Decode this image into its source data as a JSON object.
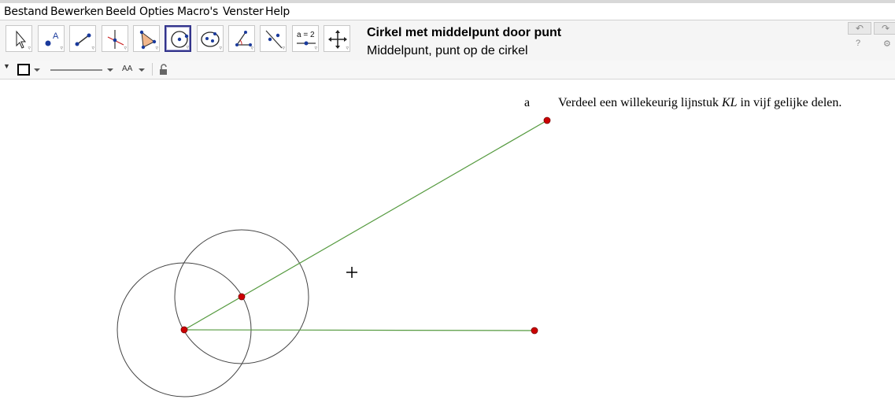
{
  "menu": [
    "Bestand",
    "Bewerken",
    "Beeld",
    "Opties",
    "Macro's",
    "Venster",
    "Help"
  ],
  "toolbar": {
    "tools": [
      {
        "name": "move-tool",
        "icon": "arrow-pointer-icon"
      },
      {
        "name": "point-tool",
        "icon": "point-icon"
      },
      {
        "name": "line-tool",
        "icon": "line-through-points-icon"
      },
      {
        "name": "perpendicular-tool",
        "icon": "perpendicular-line-icon"
      },
      {
        "name": "polygon-tool",
        "icon": "polygon-icon"
      },
      {
        "name": "circle-center-point-tool",
        "icon": "circle-center-point-icon",
        "active": true
      },
      {
        "name": "ellipse-tool",
        "icon": "ellipse-icon"
      },
      {
        "name": "angle-tool",
        "icon": "angle-icon"
      },
      {
        "name": "reflect-tool",
        "icon": "reflect-icon"
      },
      {
        "name": "slider-tool",
        "icon": "slider-icon",
        "label": "a = 2"
      },
      {
        "name": "move-view-tool",
        "icon": "move-graphics-view-icon"
      }
    ],
    "active_tool_title": "Cirkel met middelpunt door punt",
    "active_tool_help": "Middelpunt, punt op de cirkel",
    "undo_icon": "undo-icon",
    "redo_icon": "redo-icon",
    "help_icon": "help-icon",
    "settings_icon": "settings-icon"
  },
  "stylebar": {
    "point_style_icon": "square-style-icon",
    "line_style_icon": "line-style-icon",
    "label_style_label": "AA",
    "lock_icon": "lock-icon"
  },
  "canvas": {
    "label_a": "a",
    "instruction_prefix": "Verdeel een willekeurig lijnstuk ",
    "instruction_var": "KL",
    "instruction_suffix": " in vijf gelijke delen.",
    "colors": {
      "segment": "#559a3f",
      "point": "#cc0000",
      "circle": "#444444"
    }
  }
}
